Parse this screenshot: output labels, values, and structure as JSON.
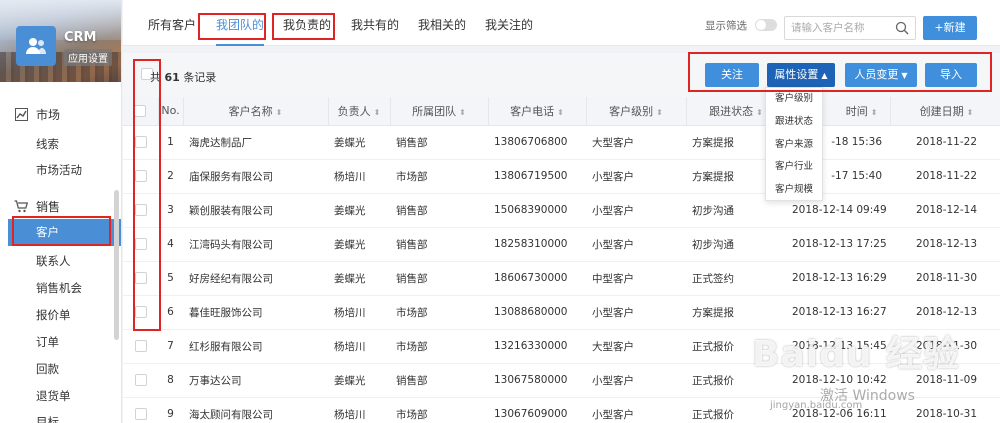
{
  "app": {
    "title": "CRM",
    "subtitle": "应用设置"
  },
  "sidebar": {
    "groups": [
      {
        "label": "市场",
        "icon": "chart-line-icon",
        "items": [
          "线索",
          "市场活动"
        ]
      },
      {
        "label": "销售",
        "icon": "cart-icon",
        "items": [
          "客户",
          "联系人",
          "销售机会",
          "报价单",
          "订单",
          "回款",
          "退货单",
          "目标"
        ]
      }
    ],
    "active_item": "客户"
  },
  "tabs": [
    "所有客户",
    "我团队的",
    "我负责的",
    "我共有的",
    "我相关的",
    "我关注的"
  ],
  "active_tab": "我团队的",
  "filter_label": "显示筛选",
  "search": {
    "placeholder": "请输入客户名称",
    "value": ""
  },
  "new_button": "+新建",
  "toolbar": {
    "total_prefix": "共",
    "total_count": "61",
    "total_suffix": "条记录",
    "follow": "关注",
    "attr_settings": "属性设置",
    "person_change": "人员变更",
    "import": "导入"
  },
  "dropdown_options": [
    "客户级别",
    "跟进状态",
    "客户来源",
    "客户行业",
    "客户规模"
  ],
  "table": {
    "headers": [
      "No.",
      "客户名称",
      "负责人",
      "所属团队",
      "客户电话",
      "客户级别",
      "跟进状态",
      "时间",
      "创建日期"
    ],
    "rows": [
      [
        "1",
        "海虎达制品厂",
        "姜蝶光",
        "销售部",
        "13806706800",
        "大型客户",
        "方案提报",
        "-18 15:36",
        "2018-11-22"
      ],
      [
        "2",
        "庙保服务有限公司",
        "杨培川",
        "市场部",
        "13806719500",
        "小型客户",
        "方案提报",
        "-17 15:40",
        "2018-11-22"
      ],
      [
        "3",
        "颖创服装有限公司",
        "姜蝶光",
        "销售部",
        "15068390000",
        "小型客户",
        "初步沟通",
        "2018-12-14 09:49",
        "2018-12-14"
      ],
      [
        "4",
        "江湾码头有限公司",
        "姜蝶光",
        "销售部",
        "18258310000",
        "小型客户",
        "初步沟通",
        "2018-12-13 17:25",
        "2018-12-13"
      ],
      [
        "5",
        "好房经纪有限公司",
        "姜蝶光",
        "销售部",
        "18606730000",
        "中型客户",
        "正式签约",
        "2018-12-13 16:29",
        "2018-11-30"
      ],
      [
        "6",
        "暮佳旺服饰公司",
        "杨培川",
        "市场部",
        "13088680000",
        "小型客户",
        "方案提报",
        "2018-12-13 16:27",
        "2018-12-13"
      ],
      [
        "7",
        "红杉服有限公司",
        "杨培川",
        "市场部",
        "13216330000",
        "大型客户",
        "正式报价",
        "2018-12-13 15:45",
        "2018-11-30"
      ],
      [
        "8",
        "万事达公司",
        "姜蝶光",
        "销售部",
        "13067580000",
        "小型客户",
        "正式报价",
        "2018-12-10 10:42",
        "2018-11-09"
      ],
      [
        "9",
        "海太顾问有限公司",
        "杨培川",
        "市场部",
        "13067609000",
        "小型客户",
        "正式报价",
        "2018-12-06 16:11",
        "2018-10-31"
      ]
    ]
  },
  "watermark": {
    "brand": "Baidu 经验",
    "url": "jingyan.baidu.com",
    "activation": "激活 Windows"
  },
  "colors": {
    "accent": "#4a8fd6",
    "button": "#3f8fdd",
    "button_dark": "#1e63b6",
    "annotation": "#e02424"
  }
}
